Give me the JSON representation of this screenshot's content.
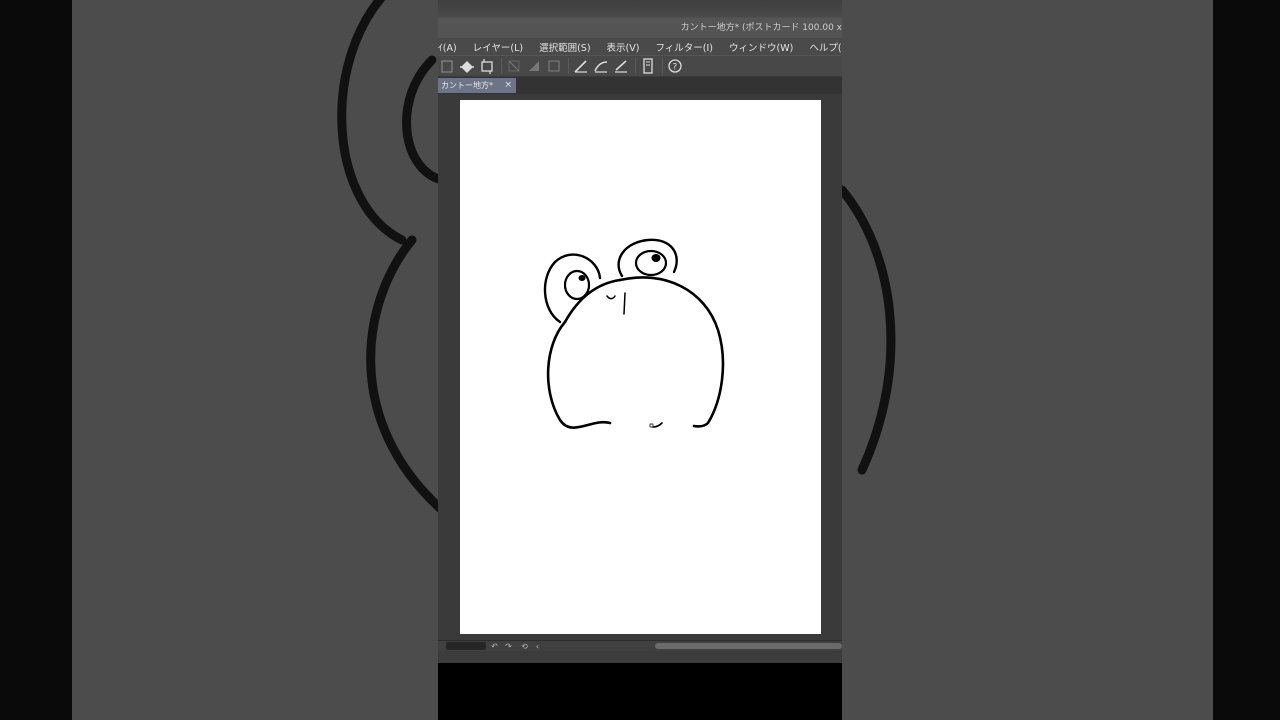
{
  "window": {
    "title": "カントー地方* (ポストカード 100.00 x"
  },
  "menu": {
    "items": [
      {
        "label": "ｲ(A)"
      },
      {
        "label": "レイヤー(L)"
      },
      {
        "label": "選択範囲(S)"
      },
      {
        "label": "表示(V)"
      },
      {
        "label": "フィルター(I)"
      },
      {
        "label": "ウィンドウ(W)"
      },
      {
        "label": "ヘルプ(H)"
      }
    ]
  },
  "toolbar": {
    "icons": [
      "clipboard-icon",
      "fill-icon",
      "transform-icon",
      "clear-selection-icon",
      "invert-selection-icon",
      "marquee-icon",
      "ruler-snap-icon",
      "curve-snap-icon",
      "grid-snap-icon",
      "device-icon",
      "help-icon"
    ]
  },
  "document_tab": {
    "label": "カントー地方*",
    "close": "×"
  },
  "statusbar": {
    "buttons": [
      "↶",
      "↷",
      "⟲",
      "‹"
    ]
  },
  "colors": {
    "accent_tab": "#6c7485",
    "background": "#4c4c4c",
    "canvas": "#ffffff",
    "ink": "#000000"
  }
}
